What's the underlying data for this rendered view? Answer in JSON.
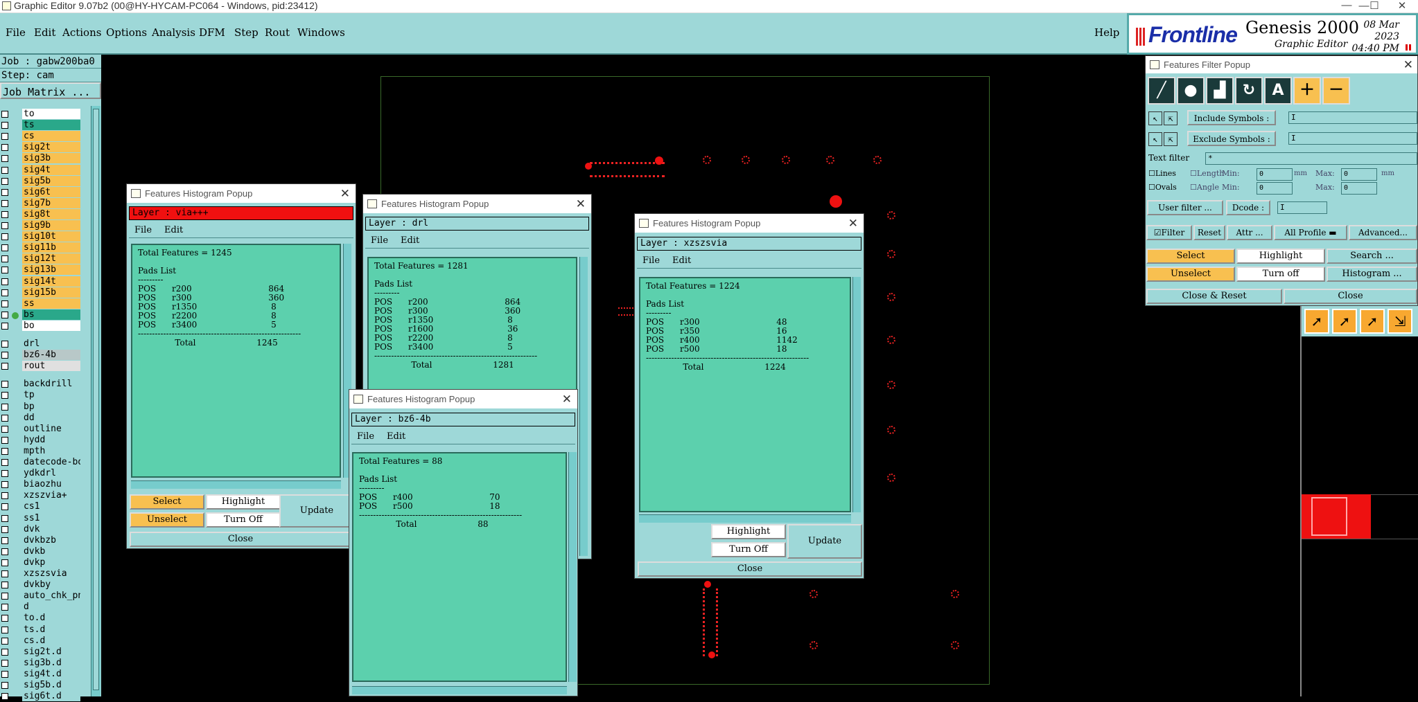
{
  "window": {
    "title": "Graphic Editor 9.07b2 (00@HY-HYCAM-PC064 - Windows, pid:23412)"
  },
  "menu": {
    "items": [
      "File",
      "Edit",
      "Actions",
      "Options",
      "Analysis",
      "DFM",
      "Step",
      "Rout",
      "Windows"
    ],
    "help": "Help"
  },
  "brand": {
    "logo": "Frontline",
    "product": "Genesis 2000",
    "sub": "Graphic Editor",
    "date": "08 Mar 2023",
    "time": "04:40 PM"
  },
  "left": {
    "job": "Job : gabw200ba0",
    "step": "Step: cam",
    "matrix": "Job Matrix ...",
    "layers": [
      {
        "name": "to",
        "color": "#ffffff"
      },
      {
        "name": "ts",
        "color": "#2aa88a"
      },
      {
        "name": "cs",
        "color": "#f8c050"
      },
      {
        "name": "sig2t",
        "color": "#f8c050"
      },
      {
        "name": "sig3b",
        "color": "#f8c050"
      },
      {
        "name": "sig4t",
        "color": "#f8c050"
      },
      {
        "name": "sig5b",
        "color": "#f8c050"
      },
      {
        "name": "sig6t",
        "color": "#f8c050"
      },
      {
        "name": "sig7b",
        "color": "#f8c050"
      },
      {
        "name": "sig8t",
        "color": "#f8c050"
      },
      {
        "name": "sig9b",
        "color": "#f8c050"
      },
      {
        "name": "sig10t",
        "color": "#f8c050"
      },
      {
        "name": "sig11b",
        "color": "#f8c050"
      },
      {
        "name": "sig12t",
        "color": "#f8c050"
      },
      {
        "name": "sig13b",
        "color": "#f8c050"
      },
      {
        "name": "sig14t",
        "color": "#f8c050"
      },
      {
        "name": "sig15b",
        "color": "#f8c050"
      },
      {
        "name": "ss",
        "color": "#f8c050"
      },
      {
        "name": "bs",
        "color": "#2aa88a"
      },
      {
        "name": "bo",
        "color": "#ffffff"
      },
      {
        "name": "drl",
        "color": "#9ed8d8"
      },
      {
        "name": "bz6-4b",
        "color": "#b8c8c8"
      },
      {
        "name": "rout",
        "color": "#e0e0e0"
      },
      {
        "name": "backdrill",
        "color": "#9ed8d8"
      },
      {
        "name": "tp",
        "color": "#9ed8d8"
      },
      {
        "name": "bp",
        "color": "#9ed8d8"
      },
      {
        "name": "dd",
        "color": "#9ed8d8"
      },
      {
        "name": "outline",
        "color": "#9ed8d8"
      },
      {
        "name": "hydd",
        "color": "#9ed8d8"
      },
      {
        "name": "mpth",
        "color": "#9ed8d8"
      },
      {
        "name": "datecode-bo",
        "color": "#9ed8d8"
      },
      {
        "name": "ydkdrl",
        "color": "#9ed8d8"
      },
      {
        "name": "biaozhu",
        "color": "#9ed8d8"
      },
      {
        "name": "xzszvia+",
        "color": "#9ed8d8"
      },
      {
        "name": "cs1",
        "color": "#9ed8d8"
      },
      {
        "name": "ss1",
        "color": "#9ed8d8"
      },
      {
        "name": "dvk",
        "color": "#9ed8d8"
      },
      {
        "name": "dvkbzb",
        "color": "#9ed8d8"
      },
      {
        "name": "dvkb",
        "color": "#9ed8d8"
      },
      {
        "name": "dvkp",
        "color": "#9ed8d8"
      },
      {
        "name": "xzszsvia",
        "color": "#9ed8d8"
      },
      {
        "name": "dvkby",
        "color": "#9ed8d8"
      },
      {
        "name": "auto_chk_pn",
        "color": "#9ed8d8"
      },
      {
        "name": "d",
        "color": "#9ed8d8"
      },
      {
        "name": "to.d",
        "color": "#9ed8d8"
      },
      {
        "name": "ts.d",
        "color": "#9ed8d8"
      },
      {
        "name": "cs.d",
        "color": "#9ed8d8"
      },
      {
        "name": "sig2t.d",
        "color": "#9ed8d8"
      },
      {
        "name": "sig3b.d",
        "color": "#9ed8d8"
      },
      {
        "name": "sig4t.d",
        "color": "#9ed8d8"
      },
      {
        "name": "sig5b.d",
        "color": "#9ed8d8"
      },
      {
        "name": "sig6t.d",
        "color": "#9ed8d8"
      }
    ]
  },
  "popups": {
    "title": "Features Histogram Popup",
    "file": "File",
    "edit": "Edit",
    "select": "Select",
    "unselect": "Unselect",
    "highlight": "Highlight",
    "turn_off": "Turn Off",
    "update": "Update",
    "close": "Close",
    "p1": {
      "layer": "Layer :  via+++",
      "text": "Total Features = 1245\n\nPads List\n---------\nPOS      r200                             864\nPOS      r300                             360\nPOS      r1350                            8\nPOS      r2200                            8\nPOS      r3400                            5\n----------------------------------------------------------\n              Total                       1245"
    },
    "p2": {
      "layer": "Layer :  drl",
      "text": "Total Features = 1281\n\nPads List\n---------\nPOS      r200                             864\nPOS      r300                             360\nPOS      r1350                            8\nPOS      r1600                            36\nPOS      r2200                            8\nPOS      r3400                            5\n----------------------------------------------------------\n              Total                       1281"
    },
    "p3": {
      "layer": "Layer :  bz6-4b",
      "text": "Total Features = 88\n\nPads List\n---------\nPOS      r400                             70\nPOS      r500                             18\n----------------------------------------------------------\n              Total                       88"
    },
    "p4": {
      "layer": "Layer :  xzszsvia",
      "text": "Total Features = 1224\n\nPads List\n---------\nPOS      r300                             48\nPOS      r350                             16\nPOS      r400                             1142\nPOS      r500                             18\n----------------------------------------------------------\n              Total                       1224"
    }
  },
  "filter": {
    "title": "Features Filter Popup",
    "include": "Include Symbols :",
    "exclude": "Exclude Symbols :",
    "text_filter": "Text filter",
    "text_filter_value": "*",
    "lines": "Lines",
    "ovals": "Ovals",
    "length": "Length",
    "angle": "Angle",
    "min": "Min:",
    "max": "Max:",
    "zero": "0",
    "unit": "mm",
    "user_filter": "User filter ...",
    "dcode": "Dcode :",
    "filter": "Filter",
    "reset": "Reset",
    "attr": "Attr ...",
    "all_profile": "All Profile",
    "advanced": "Advanced...",
    "select": "Select",
    "highlight": "Highlight",
    "search": "Search ...",
    "unselect": "Unselect",
    "turn_off": "Turn off",
    "histogram": "Histogram ...",
    "close_reset": "Close & Reset",
    "close": "Close"
  }
}
